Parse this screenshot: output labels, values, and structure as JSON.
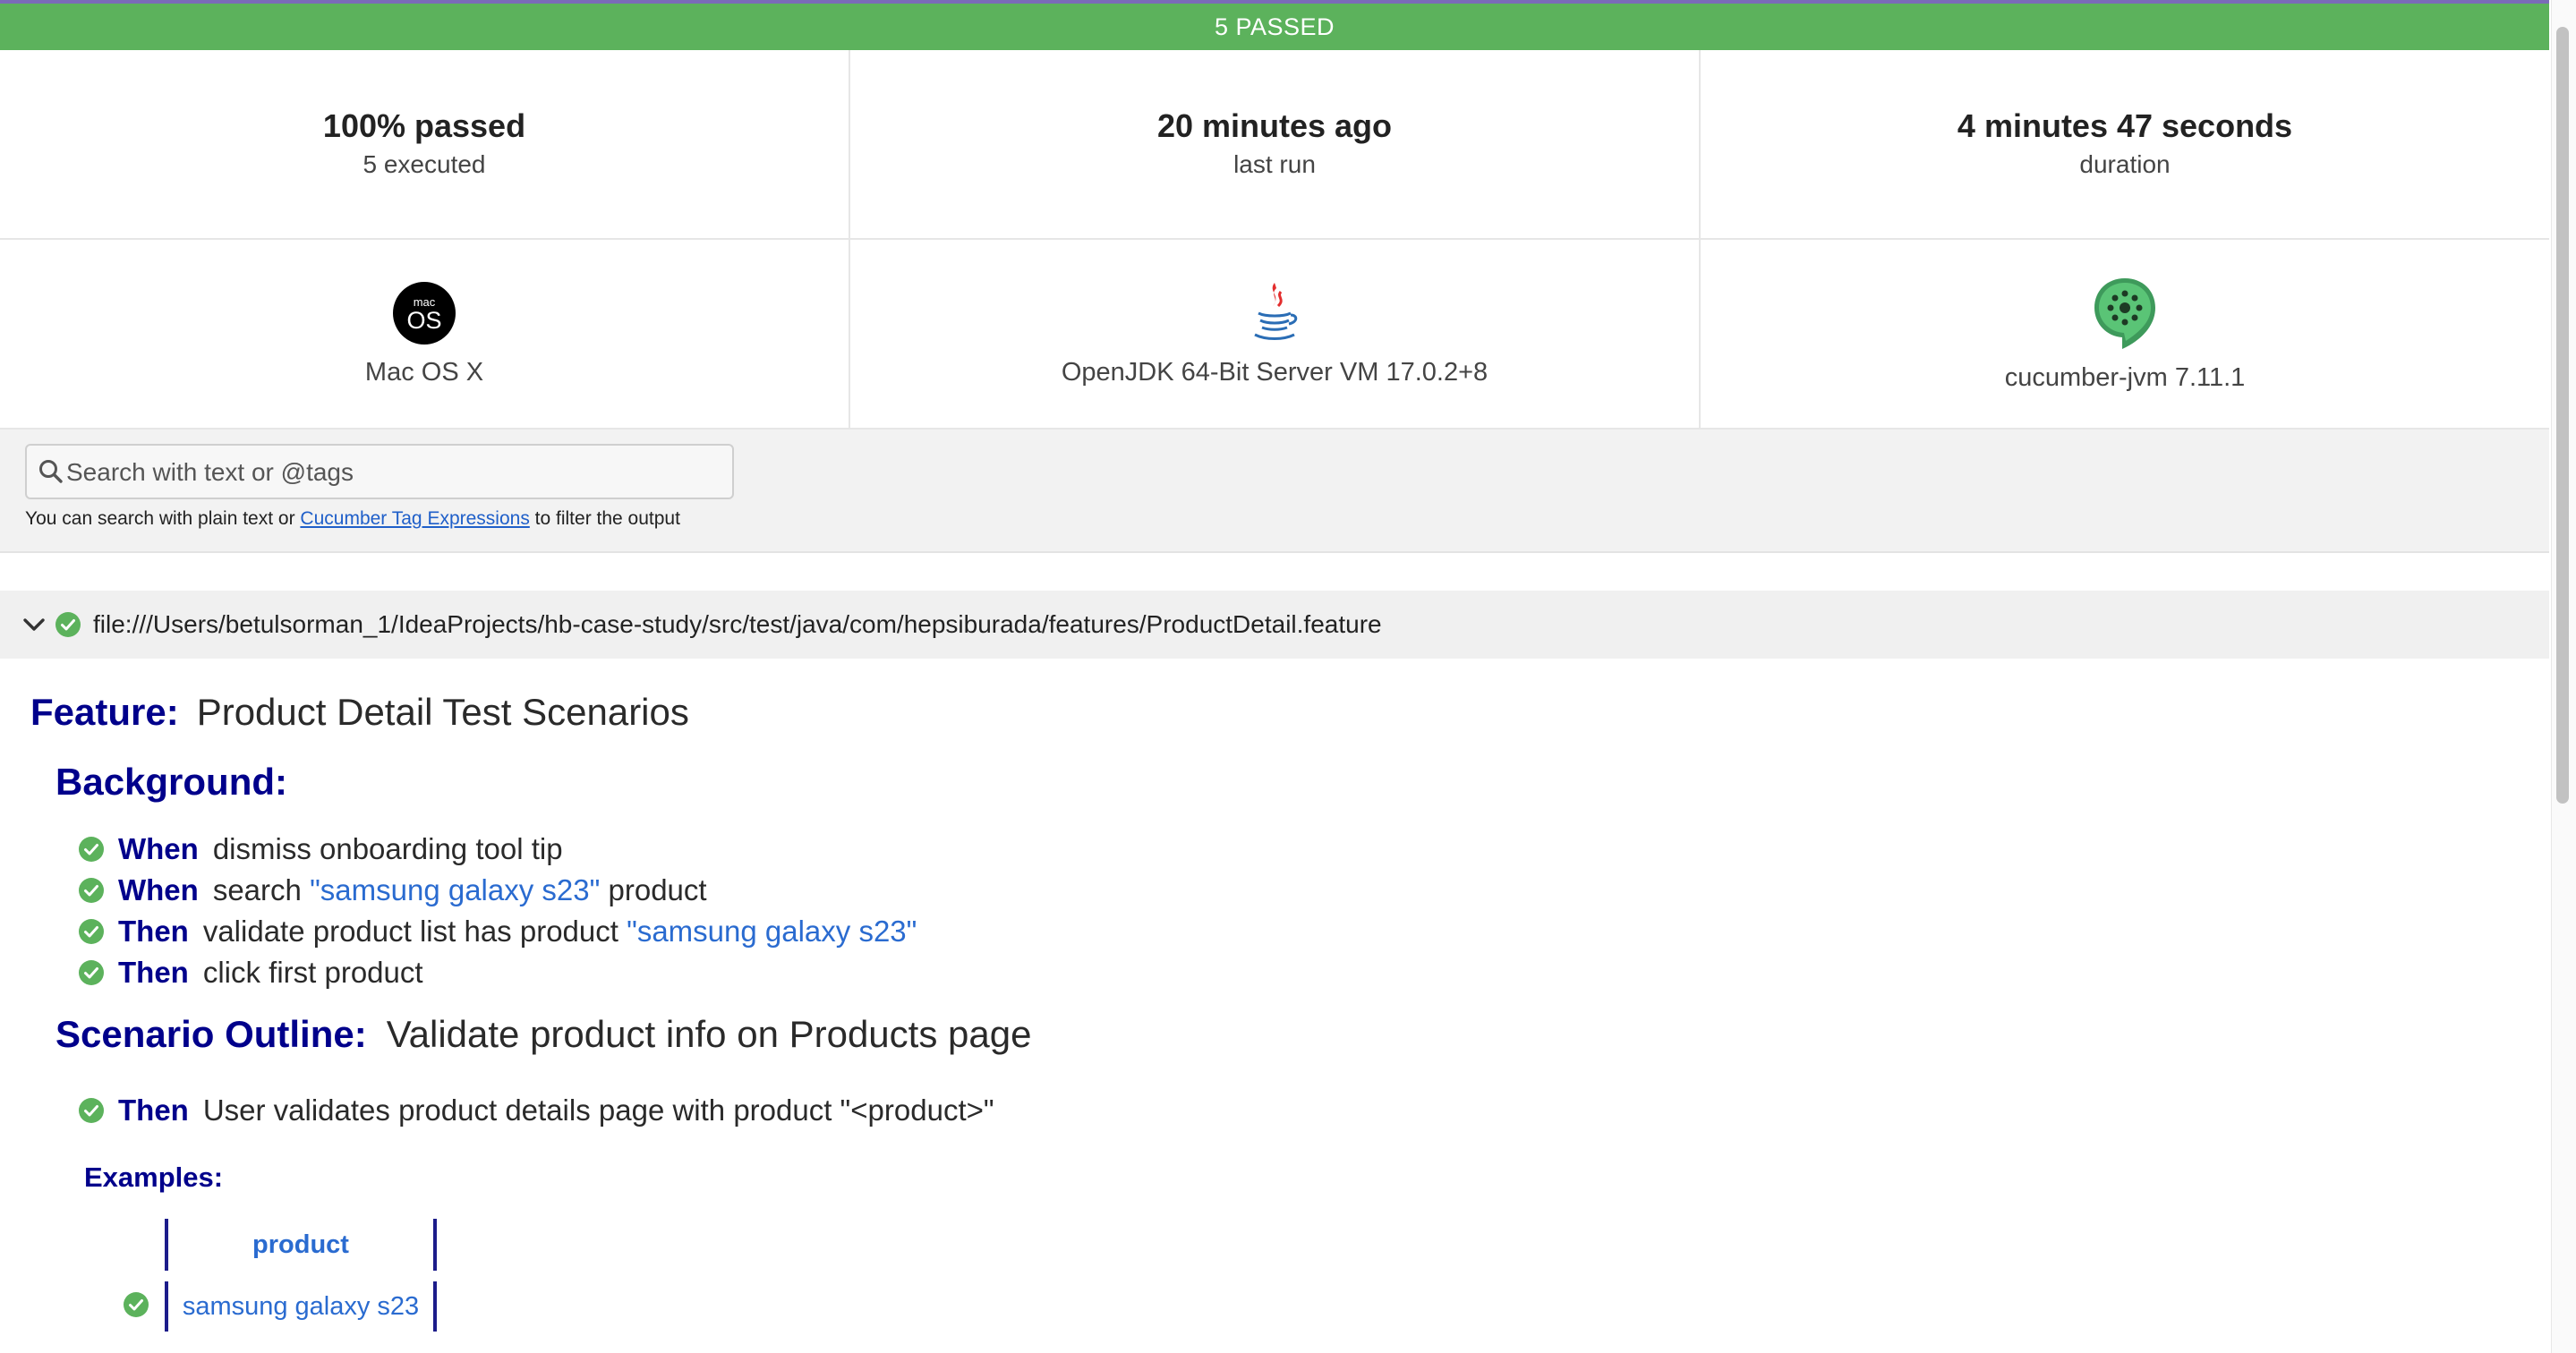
{
  "banner": {
    "status_text": "5 PASSED",
    "color": "#5cb25c"
  },
  "stats": [
    {
      "main": "100% passed",
      "sub": "5 executed"
    },
    {
      "main": "20 minutes ago",
      "sub": "last run"
    },
    {
      "main": "4 minutes 47 seconds",
      "sub": "duration"
    }
  ],
  "environment": {
    "os": {
      "label": "Mac OS X",
      "icon": "macos-icon",
      "badge_top": "mac",
      "badge_bottom": "OS"
    },
    "runtime": {
      "label": "OpenJDK 64-Bit Server VM 17.0.2+8",
      "icon": "java-icon"
    },
    "implementation": {
      "label": "cucumber-jvm 7.11.1",
      "icon": "cucumber-icon"
    }
  },
  "search": {
    "placeholder": "Search with text or @tags",
    "help_prefix": "You can search with plain text or",
    "help_link": "Cucumber Tag Expressions",
    "help_suffix": "to filter the output"
  },
  "feature_file": {
    "path": "file:///Users/betulsorman_1/IdeaProjects/hb-case-study/src/test/java/com/hepsiburada/features/ProductDetail.feature",
    "status": "passed"
  },
  "feature": {
    "keyword": "Feature:",
    "name": "Product Detail Test Scenarios",
    "background": {
      "keyword": "Background:",
      "steps": [
        {
          "keyword": "When",
          "text_before": "dismiss onboarding tool tip",
          "param": "",
          "text_after": ""
        },
        {
          "keyword": "When",
          "text_before": "search",
          "param": "\"samsung galaxy s23\"",
          "text_after": "product"
        },
        {
          "keyword": "Then",
          "text_before": "validate product list has product",
          "param": "\"samsung galaxy s23\"",
          "text_after": ""
        },
        {
          "keyword": "Then",
          "text_before": "click first product",
          "param": "",
          "text_after": ""
        }
      ]
    },
    "scenario_outline": {
      "keyword": "Scenario Outline:",
      "name": "Validate product info on Products page",
      "steps": [
        {
          "keyword": "Then",
          "text": "User validates product details page with product \"<product>\""
        }
      ],
      "examples": {
        "keyword": "Examples:",
        "header": "product",
        "rows": [
          "samsung galaxy s23"
        ]
      }
    }
  },
  "colors": {
    "keyword": "#00008b",
    "param": "#2a6bd0",
    "pass": "#5cb25c"
  }
}
